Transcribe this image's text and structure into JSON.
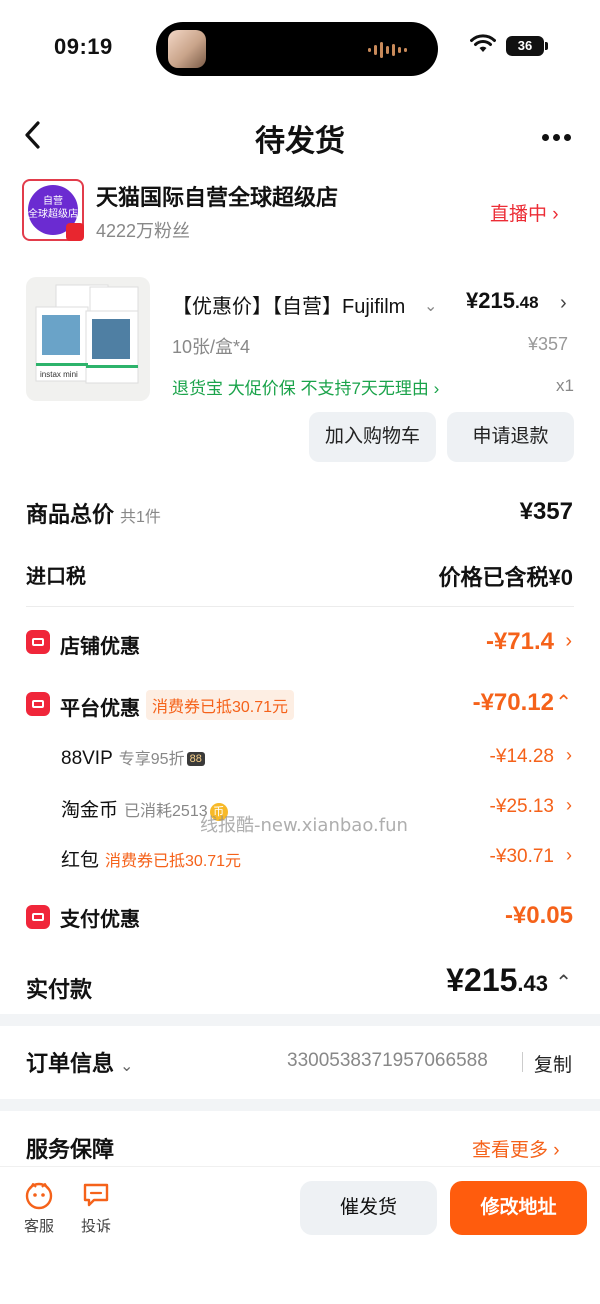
{
  "status_bar": {
    "time": "09:19",
    "battery": "36"
  },
  "nav": {
    "title": "待发货"
  },
  "store": {
    "logo_text_top": "自营",
    "logo_text_bottom": "全球超级店",
    "name": "天猫国际自营全球超级店",
    "fans": "4222万粉丝",
    "live_label": "直播中 ›"
  },
  "product": {
    "title": "【优惠价】【自营】Fujifilm",
    "price_int": "¥215",
    "price_dec": ".48",
    "spec": "10张/盒*4",
    "original_price": "¥357",
    "tags": "退货宝  大促价保  不支持7天无理由 ›",
    "qty": "x1",
    "img_brand": "instax mini",
    "add_cart": "加入购物车",
    "refund": "申请退款"
  },
  "summary": {
    "goods_total_label": "商品总价",
    "goods_total_count": "共1件",
    "goods_total_value": "¥357",
    "import_tax_label": "进口税",
    "import_tax_value": "价格已含税¥0"
  },
  "discounts": {
    "store": {
      "label": "店铺优惠",
      "value": "-¥71.4"
    },
    "platform": {
      "label": "平台优惠",
      "pill": "消费券已抵30.71元",
      "value": "-¥70.12"
    },
    "items": [
      {
        "label": "88VIP",
        "note": "专享95折",
        "badge": "88",
        "value": "-¥14.28"
      },
      {
        "label": "淘金币",
        "note": "已消耗2513",
        "badge": "币",
        "value": "-¥25.13"
      },
      {
        "label": "红包",
        "note": "消费券已抵30.71元",
        "value": "-¥30.71"
      }
    ],
    "payment": {
      "label": "支付优惠",
      "value": "-¥0.05"
    }
  },
  "payment": {
    "label": "实付款",
    "value_int": "¥215",
    "value_dec": ".43"
  },
  "order": {
    "label": "订单信息",
    "number": "3300538371957066588",
    "copy": "复制"
  },
  "service": {
    "label": "服务保障",
    "more": "查看更多 ›"
  },
  "bottom": {
    "customer_service": "客服",
    "complaint": "投诉",
    "remind": "催发货",
    "change_address": "修改地址"
  },
  "watermark": "线报酷-new.xianbao.fun",
  "colors": {
    "accent": "#f5621a",
    "red": "#ec2d36",
    "green": "#1aa34a",
    "primary_button": "#ff5c0d"
  }
}
